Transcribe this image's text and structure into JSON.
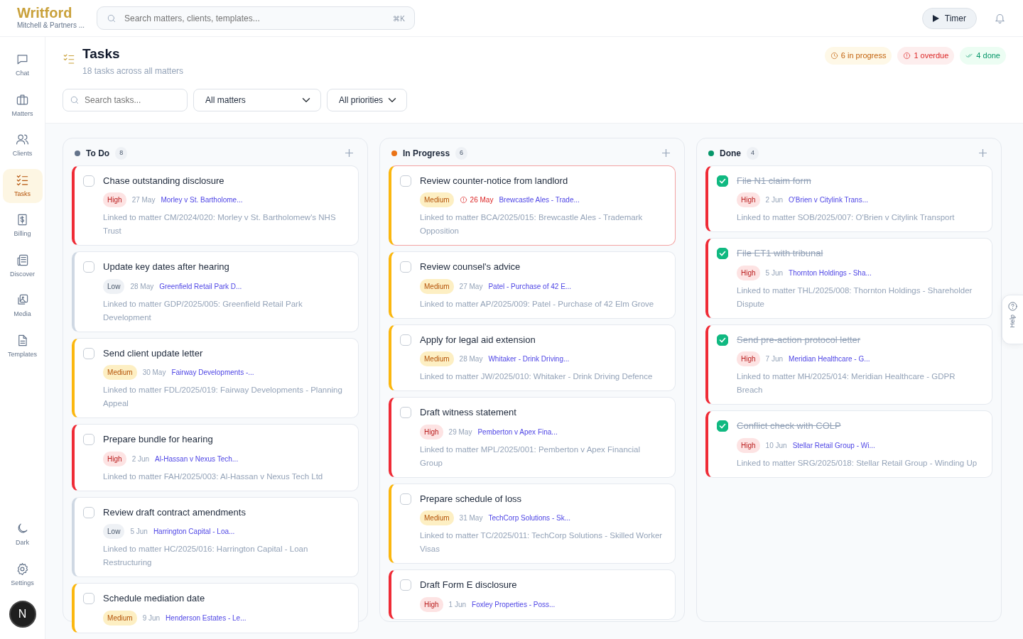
{
  "brand": {
    "name": "Writford",
    "subtitle": "Mitchell & Partners ..."
  },
  "search": {
    "placeholder": "Search matters, clients, templates...",
    "shortcut": "⌘K"
  },
  "topbar": {
    "timer_label": "Timer"
  },
  "sidebar": {
    "items": [
      {
        "label": "Chat",
        "selected": false
      },
      {
        "label": "Matters",
        "selected": false
      },
      {
        "label": "Clients",
        "selected": false
      },
      {
        "label": "Tasks",
        "selected": true
      },
      {
        "label": "Billing",
        "selected": false
      },
      {
        "label": "Discover",
        "selected": false
      },
      {
        "label": "Media",
        "selected": false
      },
      {
        "label": "Templates",
        "selected": false
      }
    ],
    "bottom": [
      {
        "label": "Dark"
      },
      {
        "label": "Settings"
      }
    ],
    "avatar": "N"
  },
  "page": {
    "title": "Tasks",
    "subtitle": "18 tasks across all matters",
    "stats": [
      {
        "kind": "progress",
        "label": "6 in progress"
      },
      {
        "kind": "overdue",
        "label": "1 overdue"
      },
      {
        "kind": "done",
        "label": "4 done"
      }
    ],
    "filters": {
      "search_placeholder": "Search tasks...",
      "matter": "All matters",
      "priority": "All priorities"
    }
  },
  "columns": [
    {
      "title": "To Do",
      "count": "8",
      "color": "#64748b",
      "tasks": [
        {
          "title": "Chase outstanding disclosure",
          "priority": "High",
          "date": "27 May",
          "overdue": false,
          "matter": "Morley v St. Bartholome...",
          "description": "Linked to matter CM/2024/020: Morley v St. Bartholomew's NHS Trust",
          "done": false
        },
        {
          "title": "Update key dates after hearing",
          "priority": "Low",
          "date": "28 May",
          "overdue": false,
          "matter": "Greenfield Retail Park D...",
          "description": "Linked to matter GDP/2025/005: Greenfield Retail Park Development",
          "done": false
        },
        {
          "title": "Send client update letter",
          "priority": "Medium",
          "date": "30 May",
          "overdue": false,
          "matter": "Fairway Developments -...",
          "description": "Linked to matter FDL/2025/019: Fairway Developments - Planning Appeal",
          "done": false
        },
        {
          "title": "Prepare bundle for hearing",
          "priority": "High",
          "date": "2 Jun",
          "overdue": false,
          "matter": "Al-Hassan v Nexus Tech...",
          "description": "Linked to matter FAH/2025/003: Al-Hassan v Nexus Tech Ltd",
          "done": false
        },
        {
          "title": "Review draft contract amendments",
          "priority": "Low",
          "date": "5 Jun",
          "overdue": false,
          "matter": "Harrington Capital - Loa...",
          "description": "Linked to matter HC/2025/016: Harrington Capital - Loan Restructuring",
          "done": false
        },
        {
          "title": "Schedule mediation date",
          "priority": "Medium",
          "date": "9 Jun",
          "overdue": false,
          "matter": "Henderson Estates - Le...",
          "done": false
        }
      ]
    },
    {
      "title": "In Progress",
      "count": "6",
      "color": "#ea7317",
      "tasks": [
        {
          "title": "Review counter-notice from landlord",
          "priority": "Medium",
          "date": "26 May",
          "overdue": true,
          "matter": "Brewcastle Ales - Trade...",
          "description": "Linked to matter BCA/2025/015: Brewcastle Ales - Trademark Opposition",
          "done": false
        },
        {
          "title": "Review counsel's advice",
          "priority": "Medium",
          "date": "27 May",
          "overdue": false,
          "matter": "Patel - Purchase of 42 E...",
          "description": "Linked to matter AP/2025/009: Patel - Purchase of 42 Elm Grove",
          "done": false
        },
        {
          "title": "Apply for legal aid extension",
          "priority": "Medium",
          "date": "28 May",
          "overdue": false,
          "matter": "Whitaker - Drink Driving...",
          "description": "Linked to matter JW/2025/010: Whitaker - Drink Driving Defence",
          "done": false
        },
        {
          "title": "Draft witness statement",
          "priority": "High",
          "date": "29 May",
          "overdue": false,
          "matter": "Pemberton v Apex Fina...",
          "description": "Linked to matter MPL/2025/001: Pemberton v Apex Financial Group",
          "done": false
        },
        {
          "title": "Prepare schedule of loss",
          "priority": "Medium",
          "date": "31 May",
          "overdue": false,
          "matter": "TechCorp Solutions - Sk...",
          "description": "Linked to matter TC/2025/011: TechCorp Solutions - Skilled Worker Visas",
          "done": false
        },
        {
          "title": "Draft Form E disclosure",
          "priority": "High",
          "date": "1 Jun",
          "overdue": false,
          "matter": "Foxley Properties - Poss...",
          "done": false
        }
      ]
    },
    {
      "title": "Done",
      "count": "4",
      "color": "#059669",
      "tasks": [
        {
          "title": "File N1 claim form",
          "priority": "High",
          "date": "2 Jun",
          "overdue": false,
          "matter": "O'Brien v Citylink Trans...",
          "description": "Linked to matter SOB/2025/007: O'Brien v Citylink Transport",
          "done": true
        },
        {
          "title": "File ET1 with tribunal",
          "priority": "High",
          "date": "5 Jun",
          "overdue": false,
          "matter": "Thornton Holdings - Sha...",
          "description": "Linked to matter THL/2025/008: Thornton Holdings - Shareholder Dispute",
          "done": true
        },
        {
          "title": "Send pre-action protocol letter",
          "priority": "High",
          "date": "7 Jun",
          "overdue": false,
          "matter": "Meridian Healthcare - G...",
          "description": "Linked to matter MH/2025/014: Meridian Healthcare - GDPR Breach",
          "done": true
        },
        {
          "title": "Conflict check with COLP",
          "priority": "High",
          "date": "10 Jun",
          "overdue": false,
          "matter": "Stellar Retail Group - Wi...",
          "description": "Linked to matter SRG/2025/018: Stellar Retail Group - Winding Up",
          "done": true
        }
      ]
    }
  ],
  "help": {
    "label": "Help"
  }
}
